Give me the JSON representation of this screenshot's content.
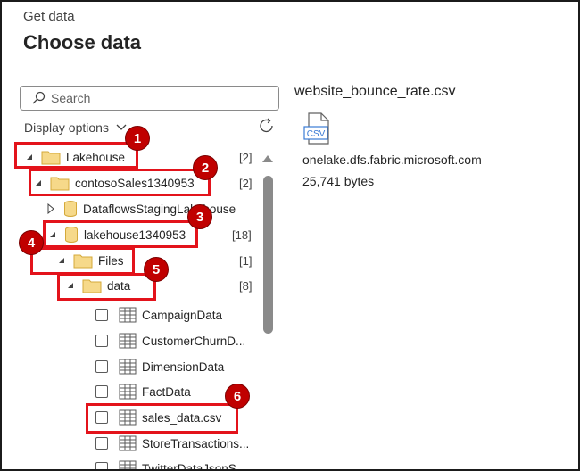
{
  "header": {
    "subtitle": "Get data",
    "title": "Choose data"
  },
  "search": {
    "placeholder": "Search"
  },
  "display_options": {
    "label": "Display options"
  },
  "tree": {
    "lakehouse": {
      "label": "Lakehouse",
      "count": "[2]"
    },
    "contoso": {
      "label": "contosoSales1340953",
      "count": "[2]"
    },
    "dataflows": {
      "label": "DataflowsStagingLakehouse"
    },
    "lakehouse_item": {
      "label": "lakehouse1340953",
      "count": "[18]"
    },
    "files": {
      "label": "Files",
      "count": "[1]"
    },
    "data_folder": {
      "label": "data",
      "count": "[8]"
    },
    "tables": [
      {
        "label": "CampaignData"
      },
      {
        "label": "CustomerChurnD..."
      },
      {
        "label": "DimensionData"
      },
      {
        "label": "FactData"
      },
      {
        "label": "sales_data.csv"
      },
      {
        "label": "StoreTransactions..."
      },
      {
        "label": "TwitterDataJsonS..."
      }
    ]
  },
  "preview": {
    "file_name": "website_bounce_rate.csv",
    "icon_text": "CSV",
    "path": "onelake.dfs.fabric.microsoft.com",
    "size": "25,741 bytes"
  },
  "annotations": [
    {
      "number": "1"
    },
    {
      "number": "2"
    },
    {
      "number": "3"
    },
    {
      "number": "4"
    },
    {
      "number": "5"
    },
    {
      "number": "6"
    }
  ],
  "colors": {
    "highlight": "#e3131b",
    "badge": "#c00000",
    "folder": "#f6d98a",
    "folder_stroke": "#d4a93a"
  }
}
